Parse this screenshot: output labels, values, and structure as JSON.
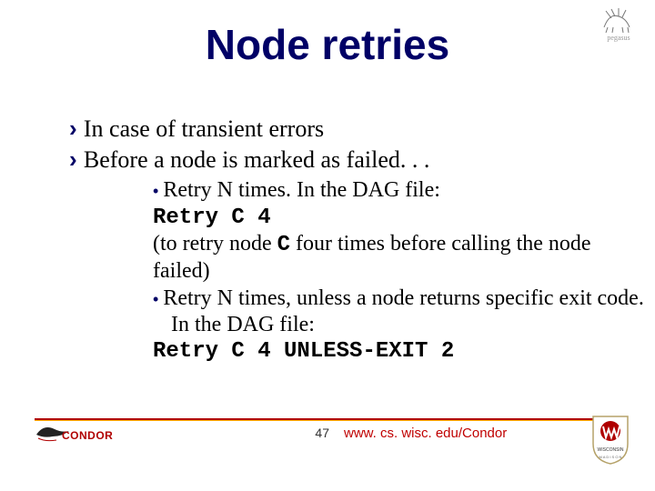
{
  "title": "Node retries",
  "bullets": {
    "b0": "In case of transient errors",
    "b1": "Before a node is marked as failed. . .",
    "s0": "Retry N times.  In the DAG file:",
    "s1": "Retry C 4",
    "s2": "(to retry node ",
    "s2b": "C",
    "s2c": " four times before calling the node failed)",
    "s3": "Retry N times, unless a node returns specific exit code. In the DAG file:",
    "s4": "Retry C 4 UNLESS-EXIT 2"
  },
  "footer": {
    "page": "47",
    "url": "www. cs. wisc. edu/Condor",
    "condor": "CONDOR",
    "pegasus": "pegasus"
  }
}
